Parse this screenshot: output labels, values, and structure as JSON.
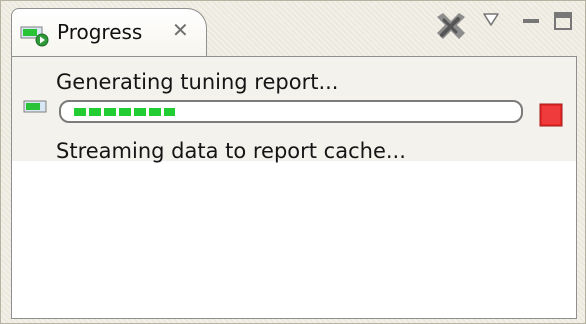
{
  "window": {
    "tab_title": "Progress",
    "tab_close_icon": "close-icon",
    "toolbar": {
      "stop_all_icon": "stop-all-icon",
      "view_menu_icon": "chevron-down-icon",
      "minimize_icon": "minimize-icon",
      "maximize_icon": "maximize-icon"
    }
  },
  "progress_job": {
    "title": "Generating tuning report...",
    "status": "Streaming data to report cache...",
    "progress_fraction": 0.24,
    "cancel_icon": "stop-icon"
  },
  "colors": {
    "tab_background": "#ffffff",
    "window_background": "#ece9d8",
    "progress_green": "#22cc33",
    "cancel_red": "#e62727",
    "icon_gray": "#777777"
  }
}
